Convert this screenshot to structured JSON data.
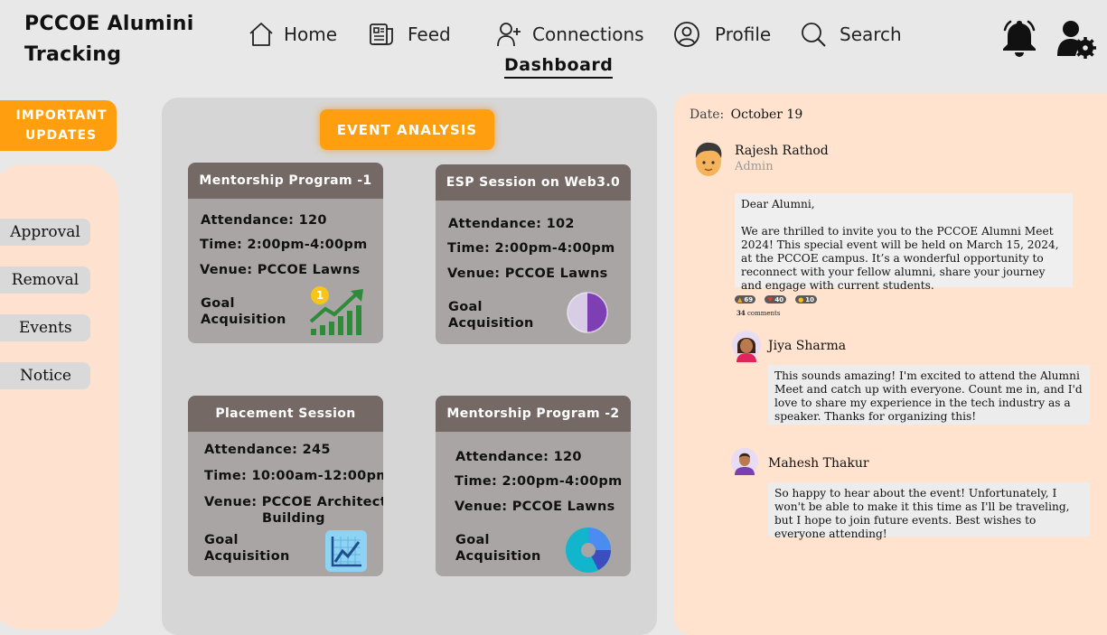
{
  "app": {
    "title": "PCCOE Alumini Tracking"
  },
  "nav": {
    "home": "Home",
    "feed": "Feed",
    "connections": "Connections",
    "profile": "Profile",
    "search": "Search",
    "dashboard": "Dashboard"
  },
  "sidebar": {
    "updates_label": "IMPORTANT UPDATES",
    "items": [
      "Approval",
      "Removal",
      "Events",
      "Notice"
    ]
  },
  "center": {
    "event_analysis_label": "EVENT ANALYSIS",
    "goal_label_1": "Goal",
    "goal_label_2": "Acquisition",
    "cards": [
      {
        "title": "Mentorship Program -1",
        "attendance": "Attendance: 120",
        "time": "Time: 2:00pm-4:00pm",
        "venue": "Venue: PCCOE Lawns",
        "badge": "1",
        "icon": "trending-up-icon"
      },
      {
        "title": "ESP Session on Web3.0",
        "attendance": "Attendance: 102",
        "time": "Time: 2:00pm-4:00pm",
        "venue": "Venue: PCCOE Lawns",
        "goal_fraction": 0.45,
        "icon": "progress-ring-icon"
      },
      {
        "title": "Placement Session",
        "attendance": "Attendance: 245",
        "time": "Time: 10:00am-12:00pm",
        "venue": "Venue: PCCOE Architecture",
        "venue_line2": "Building",
        "icon": "line-chart-icon"
      },
      {
        "title": "Mentorship Program -2",
        "attendance": "Attendance: 120",
        "time": "Time: 2:00pm-4:00pm",
        "venue": "Venue: PCCOE Lawns",
        "goal_fraction": 0.7,
        "icon": "donut-chart-icon"
      }
    ]
  },
  "feed": {
    "date_label": "Date:",
    "date_value": "October 19",
    "post": {
      "author": "Rajesh Rathod",
      "role": "Admin",
      "greeting": "Dear Alumni,",
      "body": "We are thrilled to invite you to the PCCOE Alumni Meet 2024! This special event will be held on March 15, 2024, at the PCCOE campus. It’s a wonderful opportunity to reconnect with your fellow alumni, share your journey and engage with current students.",
      "reactions": {
        "like": "69",
        "love": "40",
        "clap": "10"
      },
      "comments_count": "34",
      "comments_label": "comments"
    },
    "comments": [
      {
        "author": "Jiya Sharma",
        "text": "This sounds amazing! I'm excited to attend the Alumni Meet and catch up with everyone. Count me in, and I'd love to share my experience in the tech industry as a speaker. Thanks for organizing this!"
      },
      {
        "author": "Mahesh Thakur",
        "text": "So happy to hear about the event! Unfortunately, I won't be able to make it this time as I'll be traveling, but I hope to join future events. Best wishes to everyone attending!"
      }
    ]
  },
  "colors": {
    "accent": "#ff9f0f",
    "card_header": "#756966",
    "card_body": "#a9a5a4",
    "peach": "#ffe3cf",
    "page_bg": "#e8e8e8"
  }
}
